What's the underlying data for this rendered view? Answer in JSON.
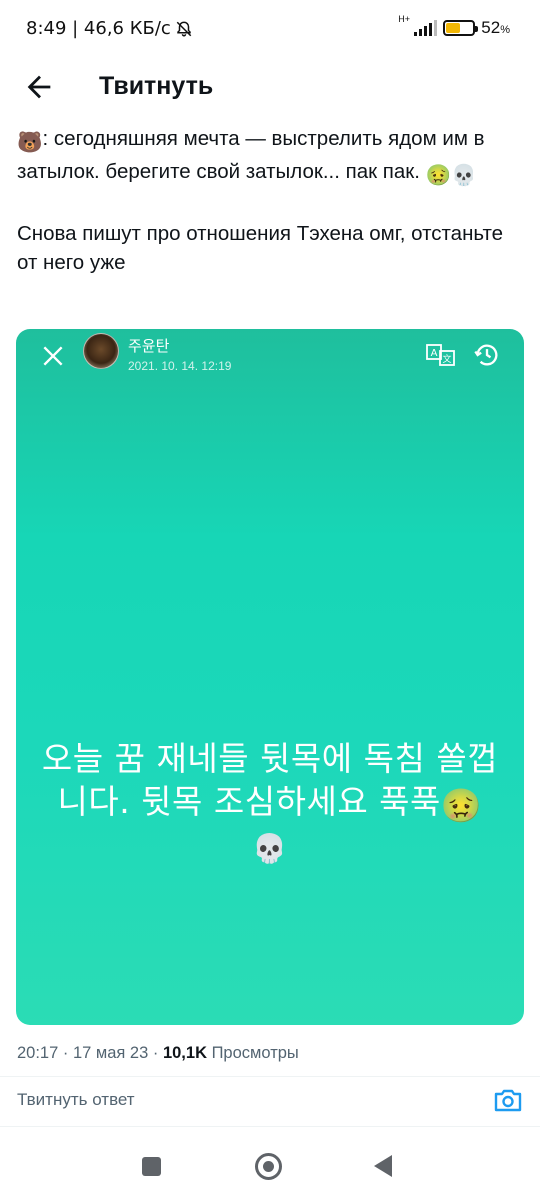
{
  "status_bar": {
    "time_and_speed": "8:49 | 46,6 КБ/с",
    "network_type": "H+",
    "battery_percent": "52",
    "battery_suffix": "%",
    "battery_level": 0.52,
    "icons": [
      "bell-off-icon",
      "signal-icon",
      "battery-icon"
    ]
  },
  "header": {
    "title": "Твитнуть",
    "back_icon": "arrow-left-icon"
  },
  "tweet": {
    "line1_emoji": "🐻",
    "paragraph1": ": сегодняшняя мечта — выстрелить ядом им в затылок. берегите свой затылок... пак пак. ",
    "paragraph1_emojis": "🤢💀",
    "paragraph2": "Снова пишут про отношения Тэхена омг, отстаньте от него уже"
  },
  "story": {
    "username": "주윤탄",
    "date": "2021. 10. 14. 12:19",
    "caption_line1": "오늘 꿈 재네들 뒷목에 독침 쏠껍",
    "caption_line2": "니다. 뒷목 조심하세요 푹푹",
    "caption_emoji1": "🤢",
    "caption_emoji2": "💀",
    "icons": [
      "close-icon",
      "translate-icon",
      "history-icon"
    ]
  },
  "meta": {
    "time": "20:17 · 17 мая 23 · ",
    "views_count": "10,1K",
    "views_label": " Просмотры"
  },
  "reply": {
    "placeholder": "Твитнуть ответ",
    "camera_icon": "camera-icon"
  },
  "colors": {
    "story_gradient_top": "#1fbf9d",
    "story_gradient_bottom": "#2bdcb5",
    "accent_blue": "#1d9bf0",
    "battery_fill": "#f2b705"
  }
}
